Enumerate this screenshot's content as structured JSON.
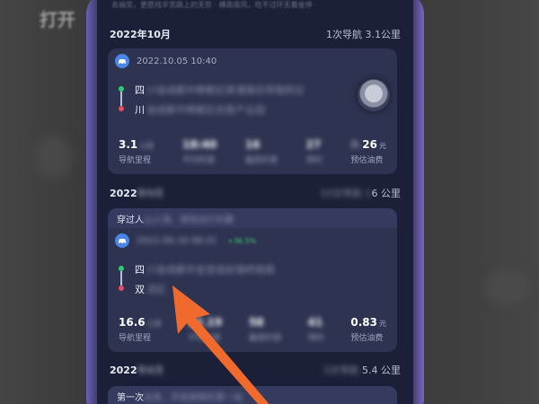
{
  "background": {
    "corner_text": "打开"
  },
  "screen": {
    "top_hint": "去抽奖，更愿找辛苦路上的无奈 · 横南南风，吃不过环无着坐停",
    "months": [
      {
        "title": "2022年10月",
        "summary": "1次导航 3.1公里"
      },
      {
        "title_prefix": "2022",
        "title_blur": "年9月",
        "summary_blur": "10次导航 1",
        "summary_suffix": "6 公里"
      },
      {
        "title_prefix": "2022",
        "title_blur": "年8月",
        "summary_blur": "3次导航 ",
        "summary_suffix": "5.4 公里"
      }
    ],
    "trips": [
      {
        "date": "2022.10.05 10:40",
        "from_prefix": "四",
        "from_blur": "川省成都市郫都区犀浦镇百草路附近",
        "to_prefix": "川",
        "to_blur": "省成都市郫都区创意产业园",
        "stats": [
          {
            "value": "3.1",
            "value_blur": "公里",
            "label": "导航里程"
          },
          {
            "value": "",
            "value_blur": "18:40",
            "label": "平均时速"
          },
          {
            "value": "",
            "value_blur": "16",
            "label": "最高时速"
          },
          {
            "value": "",
            "value_blur": "27",
            "label": "用时"
          },
          {
            "value": "",
            "value_blur": "0.",
            "value_tail": "26",
            "unit": "元",
            "label": "预估油费"
          }
        ]
      },
      {
        "banner_prefix": "穿过人",
        "banner_blur": "山人海，体验出行乐趣",
        "date_blur": "2022.09.16 08:31",
        "tag_blur": "+36.5%",
        "from_prefix": "四",
        "from_blur": "川省成都市金堂县赵镇桥南路",
        "to_prefix": "双",
        "to_blur": "流区",
        "stats": [
          {
            "value": "16.6",
            "value_blur": "公里",
            "label": "导航里程"
          },
          {
            "value": "",
            "value_blur": "22.19",
            "label": "平均时速"
          },
          {
            "value": "",
            "value_blur": "58",
            "label": "最高时速"
          },
          {
            "value": "",
            "value_blur": "41",
            "label": "用时"
          },
          {
            "value": "",
            "value_blur": "",
            "value_tail": "0.83",
            "unit": "元",
            "label": "预估油费"
          }
        ]
      },
      {
        "banner_prefix": "第一次",
        "banner_blur": "出发，开启旅程的第一站"
      }
    ],
    "stat_label_blur_prefixes": [
      "",
      "",
      "",
      "",
      ""
    ]
  }
}
